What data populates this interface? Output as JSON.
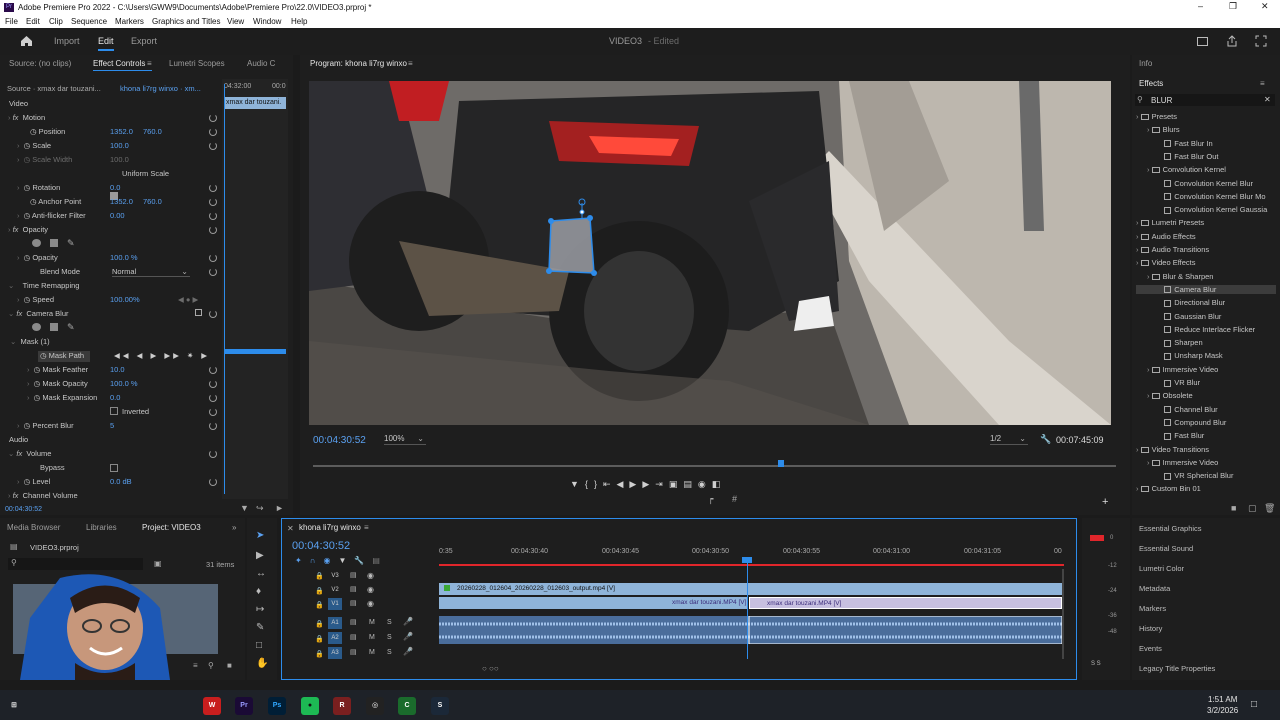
{
  "app": {
    "title": "Adobe Premiere Pro 2022 - C:\\Users\\GWW9\\Documents\\Adobe\\Premiere Pro\\22.0\\VIDEO3.prproj *",
    "logo": "Pr"
  },
  "menu": [
    "File",
    "Edit",
    "Clip",
    "Sequence",
    "Markers",
    "Graphics and Titles",
    "View",
    "Window",
    "Help"
  ],
  "workspace": {
    "tabs": [
      "Import",
      "Edit",
      "Export"
    ],
    "active": "Edit",
    "project_name": "VIDEO3",
    "status": "- Edited"
  },
  "effect_controls": {
    "tabs": [
      "Source: (no clips)",
      "Effect Controls",
      "Lumetri Scopes",
      "Audio C"
    ],
    "source_line": "Source · xmax dar touzani...",
    "sequence_line": "khona li7rg winxo · xm...",
    "timecode_top": "04:32:00",
    "timecode_top2": "00:0",
    "clip_name": "xmax dar touzani.",
    "video_header": "Video",
    "motion": "Motion",
    "position_label": "Position",
    "position_x": "1352.0",
    "position_y": "760.0",
    "scale_label": "Scale",
    "scale_val": "100.0",
    "scale_width_label": "Scale Width",
    "scale_width_val": "100.0",
    "uniform_scale": "Uniform Scale",
    "rotation_label": "Rotation",
    "rotation_val": "0.0",
    "anchor_label": "Anchor Point",
    "anchor_x": "1352.0",
    "anchor_y": "760.0",
    "antiflicker_label": "Anti-flicker Filter",
    "antiflicker_val": "0.00",
    "opacity_header": "Opacity",
    "opacity_label": "Opacity",
    "opacity_val": "100.0 %",
    "blend_label": "Blend Mode",
    "blend_val": "Normal",
    "time_remap": "Time Remapping",
    "speed_label": "Speed",
    "speed_val": "100.00%",
    "camera_blur": "Camera Blur",
    "mask": "Mask (1)",
    "mask_path": "Mask Path",
    "mask_feather_label": "Mask Feather",
    "mask_feather_val": "10.0",
    "mask_opacity_label": "Mask Opacity",
    "mask_opacity_val": "100.0 %",
    "mask_expansion_label": "Mask Expansion",
    "mask_expansion_val": "0.0",
    "inverted": "Inverted",
    "percent_blur_label": "Percent Blur",
    "percent_blur_val": "5",
    "audio_header": "Audio",
    "volume": "Volume",
    "bypass": "Bypass",
    "level_label": "Level",
    "level_val": "0.0 dB",
    "channel_volume": "Channel Volume",
    "current_tc": "00:04:30:52"
  },
  "program": {
    "title": "Program: khona li7rg winxo",
    "timecode": "00:04:30:52",
    "zoom": "100%",
    "resolution": "1/2",
    "duration": "00:07:45:09",
    "playhead_fraction": 0.583
  },
  "effects": {
    "info_tab": "Info",
    "tab": "Effects",
    "search": "BLUR",
    "items": [
      {
        "label": "Presets",
        "indent": 0,
        "type": "folder"
      },
      {
        "label": "Blurs",
        "indent": 1,
        "type": "folder"
      },
      {
        "label": "Fast Blur In",
        "indent": 2,
        "type": "fx"
      },
      {
        "label": "Fast Blur Out",
        "indent": 2,
        "type": "fx"
      },
      {
        "label": "Convolution Kernel",
        "indent": 1,
        "type": "folder"
      },
      {
        "label": "Convolution Kernel Blur",
        "indent": 2,
        "type": "fx"
      },
      {
        "label": "Convolution Kernel Blur Mo",
        "indent": 2,
        "type": "fx"
      },
      {
        "label": "Convolution Kernel Gaussia",
        "indent": 2,
        "type": "fx"
      },
      {
        "label": "Lumetri Presets",
        "indent": 0,
        "type": "folder"
      },
      {
        "label": "Audio Effects",
        "indent": 0,
        "type": "folder"
      },
      {
        "label": "Audio Transitions",
        "indent": 0,
        "type": "folder"
      },
      {
        "label": "Video Effects",
        "indent": 0,
        "type": "folder"
      },
      {
        "label": "Blur & Sharpen",
        "indent": 1,
        "type": "folder"
      },
      {
        "label": "Camera Blur",
        "indent": 2,
        "type": "fx",
        "selected": true
      },
      {
        "label": "Directional Blur",
        "indent": 2,
        "type": "fx"
      },
      {
        "label": "Gaussian Blur",
        "indent": 2,
        "type": "fx"
      },
      {
        "label": "Reduce Interlace Flicker",
        "indent": 2,
        "type": "fx"
      },
      {
        "label": "Sharpen",
        "indent": 2,
        "type": "fx"
      },
      {
        "label": "Unsharp Mask",
        "indent": 2,
        "type": "fx"
      },
      {
        "label": "Immersive Video",
        "indent": 1,
        "type": "folder"
      },
      {
        "label": "VR Blur",
        "indent": 2,
        "type": "fx"
      },
      {
        "label": "Obsolete",
        "indent": 1,
        "type": "folder"
      },
      {
        "label": "Channel Blur",
        "indent": 2,
        "type": "fx"
      },
      {
        "label": "Compound Blur",
        "indent": 2,
        "type": "fx"
      },
      {
        "label": "Fast Blur",
        "indent": 2,
        "type": "fx"
      },
      {
        "label": "Video Transitions",
        "indent": 0,
        "type": "folder"
      },
      {
        "label": "Immersive Video",
        "indent": 1,
        "type": "folder"
      },
      {
        "label": "VR Spherical Blur",
        "indent": 2,
        "type": "fx"
      },
      {
        "label": "Custom Bin 01",
        "indent": 0,
        "type": "folder"
      }
    ]
  },
  "right_panels": [
    "Essential Graphics",
    "Essential Sound",
    "Lumetri Color",
    "Metadata",
    "Markers",
    "History",
    "Events",
    "Legacy Title Properties"
  ],
  "project": {
    "tabs": [
      "Media Browser",
      "Libraries",
      "Project: VIDEO3"
    ],
    "file": "VIDEO3.prproj",
    "items_count": "31 items"
  },
  "timeline": {
    "tab": "khona li7rg winxo",
    "timecode": "00:04:30:52",
    "ruler": [
      "0:35",
      "00:04:30:40",
      "00:04:30:45",
      "00:04:30:50",
      "00:04:30:55",
      "00:04:31:00",
      "00:04:31:05",
      "00"
    ],
    "tracks": [
      "V3",
      "V2",
      "V1",
      "A1",
      "A2",
      "A3"
    ],
    "track_btns": [
      "M",
      "S"
    ],
    "clip_v2": "20260228_012604_20260228_012603_output.mp4 [V]",
    "clip_v1a": "xmax dar touzani.MP4 [V]",
    "clip_v1b": "xmax dar touzani.MP4 [V]",
    "meter_labels": [
      "0",
      "-12",
      "-24",
      "-36",
      "-48"
    ],
    "meter_solo": "S S"
  },
  "taskbar": {
    "time": "1:51 AM",
    "date": "3/2/2026",
    "icons": [
      "windows-icon",
      "wps-icon",
      "premiere-icon",
      "photoshop-icon",
      "spotify-icon",
      "winrar-icon",
      "chrome-icon",
      "camtasia-icon",
      "steam-icon"
    ],
    "labels": [
      "⊞",
      "W",
      "Pr",
      "Ps",
      "●",
      "R",
      "◎",
      "C",
      "S"
    ]
  },
  "colors": {
    "accent": "#2d8ceb",
    "clip_blue": "#8fb4d9",
    "clip_purple": "#b9b0d8",
    "audio_blue": "#4a6d9b",
    "red": "#e0262b"
  }
}
